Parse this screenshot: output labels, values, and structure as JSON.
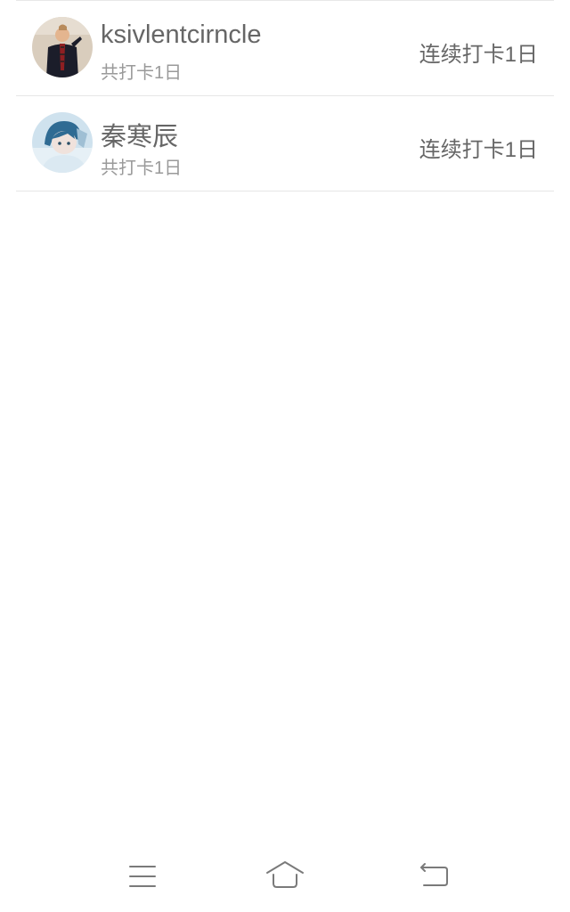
{
  "list": {
    "items": [
      {
        "name": "ksivlentcirncle",
        "total": "共打卡1日",
        "streak": "连续打卡1日"
      },
      {
        "name": "秦寒辰",
        "total": "共打卡1日",
        "streak": "连续打卡1日"
      }
    ]
  },
  "navbar": {
    "icons": [
      "menu-icon",
      "home-icon",
      "back-icon"
    ],
    "color": "#7a7a7a"
  },
  "colors": {
    "primary_text": "#666666",
    "secondary_text": "#9a9a9a",
    "divider": "#e6e6e6"
  }
}
